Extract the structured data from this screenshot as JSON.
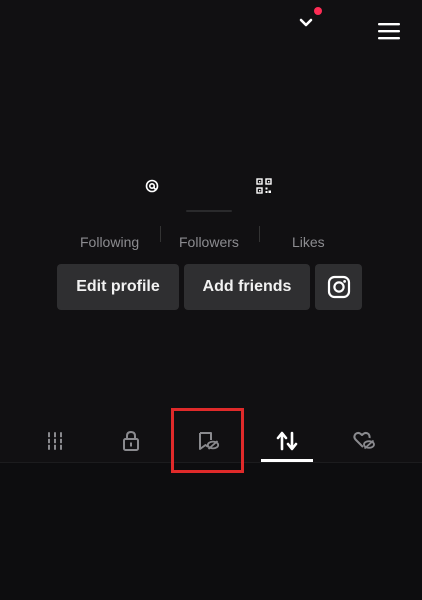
{
  "header": {
    "account_switcher_icon": "chevron-down-icon",
    "notification_dot_color": "#fe2c55",
    "menu_icon": "hamburger-menu-icon"
  },
  "profile": {
    "username_icon": "at-sign-icon",
    "qr_icon": "qr-code-icon"
  },
  "stats": {
    "following_label": "Following",
    "followers_label": "Followers",
    "likes_label": "Likes"
  },
  "actions": {
    "edit_profile_label": "Edit profile",
    "add_friends_label": "Add friends",
    "instagram_icon": "instagram-icon"
  },
  "tabs": [
    {
      "name": "videos",
      "icon": "grid-bars-icon",
      "active": false
    },
    {
      "name": "private",
      "icon": "lock-icon",
      "active": false
    },
    {
      "name": "favorites-hidden",
      "icon": "bookmark-eye-off-icon",
      "active": false,
      "highlighted": true
    },
    {
      "name": "reposts",
      "icon": "repost-icon",
      "active": true
    },
    {
      "name": "liked-hidden",
      "icon": "heart-eye-off-icon",
      "active": false
    }
  ],
  "highlight_color": "#e02a2a"
}
